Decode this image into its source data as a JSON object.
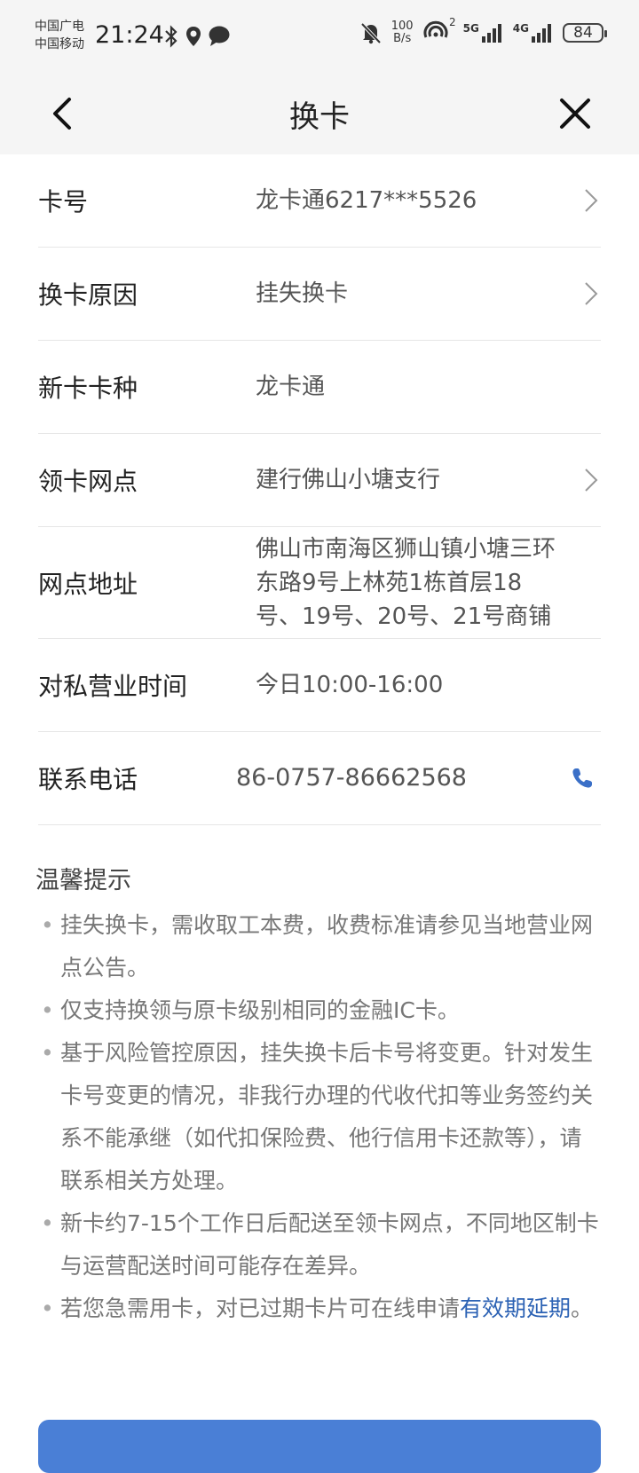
{
  "status_bar": {
    "carrier_1": "中国广电",
    "carrier_2": "中国移动",
    "time": "21:24",
    "net_speed_value": "100",
    "net_speed_unit": "B/s",
    "signal_1_label": "5G",
    "signal_2_label": "4G",
    "hotspot_sub": "2",
    "battery": "84"
  },
  "header": {
    "title": "换卡"
  },
  "form": {
    "rows": [
      {
        "label": "卡号",
        "value": "龙卡通6217***5526"
      },
      {
        "label": "换卡原因",
        "value": "挂失换卡"
      },
      {
        "label": "新卡卡种",
        "value": "龙卡通"
      },
      {
        "label": "领卡网点",
        "value": "建行佛山小塘支行"
      },
      {
        "label": "网点地址",
        "value": "佛山市南海区狮山镇小塘三环东路9号上林苑1栋首层18号、19号、20号、21号商铺"
      },
      {
        "label": "对私营业时间",
        "value": "今日10:00-16:00"
      },
      {
        "label": "联系电话",
        "value": "86-0757-86662568"
      }
    ]
  },
  "tips": {
    "title": "温馨提示",
    "items": [
      "挂失换卡，需收取工本费，收费标准请参见当地营业网点公告。",
      "仅支持换领与原卡级别相同的金融IC卡。",
      "基于风险管控原因，挂失换卡后卡号将变更。针对发生卡号变更的情况，非我行办理的代收代扣等业务签约关系不能承继（如代扣保险费、他行信用卡还款等），请联系相关方处理。",
      "新卡约7-15个工作日后配送至领卡网点，不同地区制卡与运营配送时间可能存在差异。"
    ],
    "last_item_prefix": "若您急需用卡，对已过期卡片可在线申请",
    "last_item_link": "有效期延期",
    "last_item_suffix": "。"
  },
  "colors": {
    "link": "#2c62b4",
    "phone_icon": "#3a6fc7",
    "button": "#4a7fd6"
  }
}
